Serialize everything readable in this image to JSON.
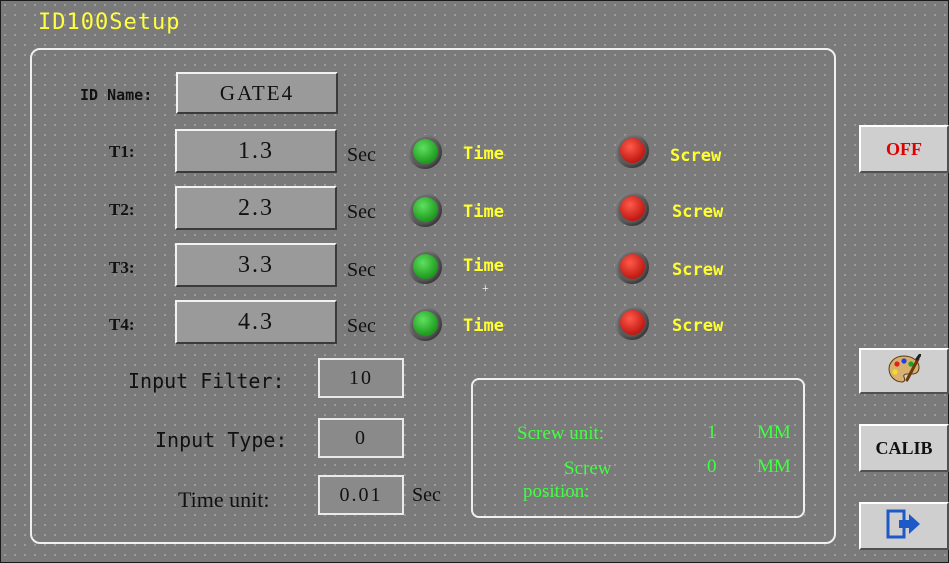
{
  "window": {
    "title": "ID100Setup"
  },
  "id_name": {
    "label": "ID Name:",
    "value": "GATE4"
  },
  "timers": [
    {
      "label": "T1:",
      "value": "1.3",
      "unit": "Sec",
      "time_label": "Time",
      "screw_label": "Screw"
    },
    {
      "label": "T2:",
      "value": "2.3",
      "unit": "Sec",
      "time_label": "Time",
      "screw_label": "Screw"
    },
    {
      "label": "T3:",
      "value": "3.3",
      "unit": "Sec",
      "time_label": "Time",
      "screw_label": "Screw"
    },
    {
      "label": "T4:",
      "value": "4.3",
      "unit": "Sec",
      "time_label": "Time",
      "screw_label": "Screw"
    }
  ],
  "input_filter": {
    "label": "Input Filter:",
    "value": "10"
  },
  "input_type": {
    "label": "Input Type:",
    "value": "0"
  },
  "time_unit": {
    "label": "Time unit:",
    "value": "0.01",
    "unit": "Sec"
  },
  "screw": {
    "unit_label": "Screw unit:",
    "unit_value": "1",
    "unit_mm": "MM",
    "position_label_1": "Screw",
    "position_label_2": "position:",
    "position_value": "0",
    "position_mm": "MM"
  },
  "buttons": {
    "off_label": "OFF",
    "calib_label": "CALIB"
  },
  "cursor_glyph": "+",
  "colors": {
    "led_time": "#2fb82f",
    "led_screw": "#d0201a",
    "accent_yellow": "#ffff30",
    "accent_green": "#40ff40",
    "off_red": "#e00000"
  },
  "icons": {
    "palette": "palette-icon",
    "exit": "exit-icon"
  }
}
